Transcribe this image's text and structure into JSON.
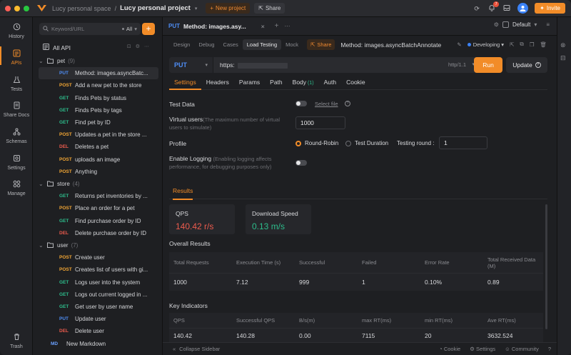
{
  "colors": {
    "accent": "#f28c28",
    "get": "#2dbd8c",
    "post": "#f2a634",
    "put": "#4e8df5",
    "delete": "#ec5b4d",
    "qps_value": "#ec5b4d",
    "speed_value": "#2dbd8c"
  },
  "titlebar": {
    "space": "Lucy personal space",
    "separator": "/",
    "project": "Lucy personal project",
    "new_project": "New project",
    "share": "Share",
    "notif_count": "7",
    "invite": "Invite",
    "icons": [
      "refresh-icon",
      "bell-icon",
      "inbox-icon",
      "avatar",
      "gift-icon"
    ]
  },
  "nav": {
    "items": [
      {
        "label": "History",
        "icon": "clock-icon"
      },
      {
        "label": "APIs",
        "icon": "api-icon"
      },
      {
        "label": "Tests",
        "icon": "flask-icon"
      },
      {
        "label": "Share Docs",
        "icon": "docs-icon"
      },
      {
        "label": "Schemas",
        "icon": "schema-icon"
      },
      {
        "label": "Settings",
        "icon": "gear-icon"
      },
      {
        "label": "Manage",
        "icon": "grid-icon"
      }
    ],
    "trash": "Trash"
  },
  "tree": {
    "search_placeholder": "Keyword/URL",
    "filter": "All",
    "all_api": "All API",
    "groups": [
      {
        "name": "pet",
        "count": "(9)",
        "items": [
          {
            "method": "PUT",
            "name": "Method: images.asyncBatc..."
          },
          {
            "method": "POST",
            "name": "Add a new pet to the store"
          },
          {
            "method": "GET",
            "name": "Finds Pets by status"
          },
          {
            "method": "GET",
            "name": "Finds Pets by tags"
          },
          {
            "method": "GET",
            "name": "Find pet by ID"
          },
          {
            "method": "POST",
            "name": "Updates a pet in the store ..."
          },
          {
            "method": "DEL",
            "name": "Deletes a pet"
          },
          {
            "method": "POST",
            "name": "uploads an image"
          },
          {
            "method": "POST",
            "name": "Anything"
          }
        ]
      },
      {
        "name": "store",
        "count": "(4)",
        "items": [
          {
            "method": "GET",
            "name": "Returns pet inventories by ..."
          },
          {
            "method": "POST",
            "name": "Place an order for a pet"
          },
          {
            "method": "GET",
            "name": "Find purchase order by ID"
          },
          {
            "method": "DEL",
            "name": "Delete purchase order by ID"
          }
        ]
      },
      {
        "name": "user",
        "count": "(7)",
        "items": [
          {
            "method": "POST",
            "name": "Create user"
          },
          {
            "method": "POST",
            "name": "Creates list of users with gi..."
          },
          {
            "method": "GET",
            "name": "Logs user into the system"
          },
          {
            "method": "GET",
            "name": "Logs out current logged in ..."
          },
          {
            "method": "GET",
            "name": "Get user by user name"
          },
          {
            "method": "PUT",
            "name": "Update user"
          },
          {
            "method": "DEL",
            "name": "Delete user"
          }
        ]
      }
    ],
    "markdown": {
      "method": "MD",
      "name": "New Markdown"
    }
  },
  "main": {
    "tab": {
      "method": "PUT",
      "title": "Method: images.asy..."
    },
    "env": "Default",
    "subtabs": [
      "Design",
      "Debug",
      "Cases",
      "Load Testing",
      "Mock"
    ],
    "share": "Share",
    "endpoint": "Method: images.asyncBatchAnnotate",
    "status": "Developing",
    "method": "PUT",
    "url": "https:",
    "http_version": "http/1.1",
    "run": "Run",
    "update": "Update",
    "request_tabs": [
      "Settings",
      "Headers",
      "Params",
      "Path",
      "Body",
      "Auth",
      "Cookie"
    ],
    "body_count": "(1)",
    "test_data": {
      "label": "Test Data",
      "select_file": "Select file"
    },
    "virtual_users": {
      "label": "Virtual users",
      "hint": "(The maximum number of virtual users to simulate)",
      "value": "1000"
    },
    "profile": {
      "label": "Profile",
      "opt1": "Round-Robin",
      "opt2": "Test Duration",
      "round_label": "Testing round :",
      "round_value": "1"
    },
    "logging": {
      "label": "Enable Logging",
      "hint": "(Enabling logging affects performance, for debugging purposes only)"
    },
    "results_tab": "Results",
    "cards": {
      "qps_title": "QPS",
      "qps_value": "140.42 r/s",
      "speed_title": "Download Speed",
      "speed_value": "0.13 m/s"
    },
    "overall": {
      "title": "Overall Results",
      "headers": [
        "Total Requests",
        "Execution Time (s)",
        "Successful",
        "Failed",
        "Error Rate",
        "Total Received Data (M)"
      ],
      "values": [
        "1000",
        "7.12",
        "999",
        "1",
        "0.10%",
        "0.89"
      ]
    },
    "key": {
      "title": "Key Indicators",
      "headers": [
        "QPS",
        "Successful QPS",
        "B/s(m)",
        "max RT(ms)",
        "min RT(ms)",
        "Ave RT(ms)"
      ],
      "values": [
        "140.42",
        "140.28",
        "0.00",
        "7115",
        "20",
        "3632.524"
      ]
    },
    "statusbar": {
      "collapse": "Collapse Sidebar",
      "cookie": "Cookie",
      "settings": "Settings",
      "community": "Community"
    }
  }
}
